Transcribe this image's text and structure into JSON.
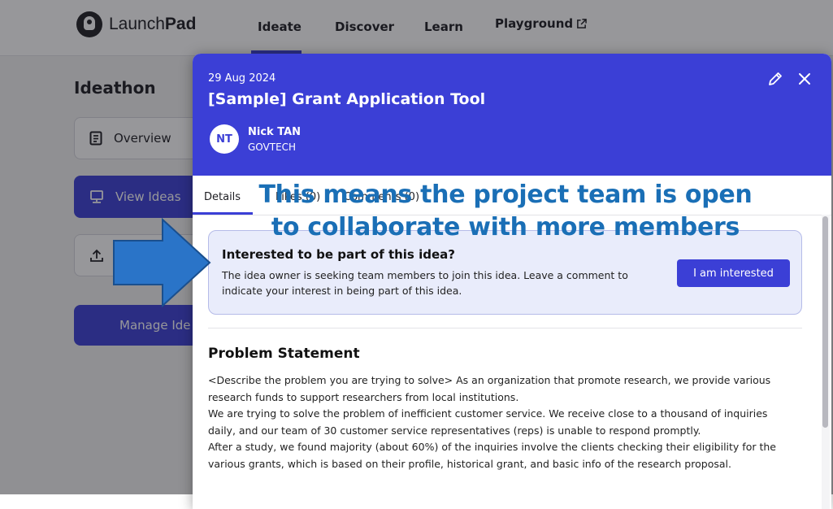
{
  "app": {
    "logo_text_light": "Launch",
    "logo_text_bold": "Pad",
    "nav": {
      "ideate": "Ideate",
      "discover": "Discover",
      "learn": "Learn",
      "playground": "Playground"
    }
  },
  "sidebar": {
    "title": "Ideathon",
    "items": [
      {
        "label": "Overview",
        "icon": "document-icon"
      },
      {
        "label": "View Ideas",
        "icon": "monitor-icon"
      },
      {
        "label": "",
        "icon": "upload-icon"
      }
    ],
    "manage_button": "Manage Ide"
  },
  "modal": {
    "date": "29 Aug 2024",
    "title": "[Sample] Grant Application Tool",
    "owner": {
      "initials": "NT",
      "name": "Nick TAN",
      "org": "GOVTECH"
    },
    "tabs": {
      "details": "Details",
      "likes": "Likes (0)",
      "comments": "Comments (0)"
    },
    "interest": {
      "title": "Interested to be part of this idea?",
      "description": "The idea owner is seeking team members to join this idea. Leave a comment to indicate your interest in being part of this idea.",
      "button": "I am interested"
    },
    "problem": {
      "heading": "Problem Statement",
      "lines": [
        "<Describe the problem you are trying to solve> As an organization that promote research, we provide various",
        "research funds to support researchers from local institutions.",
        "We are trying to solve the problem of inefficient customer service.  We receive close to a thousand of inquiries",
        "daily, and our team of 30 customer service representatives (reps) is unable to respond promptly.",
        "After a study, we found majority (about 60%) of the inquiries involve the clients checking their eligibility for the",
        "various grants, which is based on their profile, historical grant, and basic info of the research proposal."
      ]
    }
  },
  "annotation": {
    "line1": "This means the project team is open",
    "line2": "to collaborate with more members"
  },
  "colors": {
    "brand": "#3b3fd6",
    "annotation_text": "#1a6fb6",
    "annotation_arrow": "#2a74c8",
    "interest_card_bg": "#e9ecfb"
  }
}
